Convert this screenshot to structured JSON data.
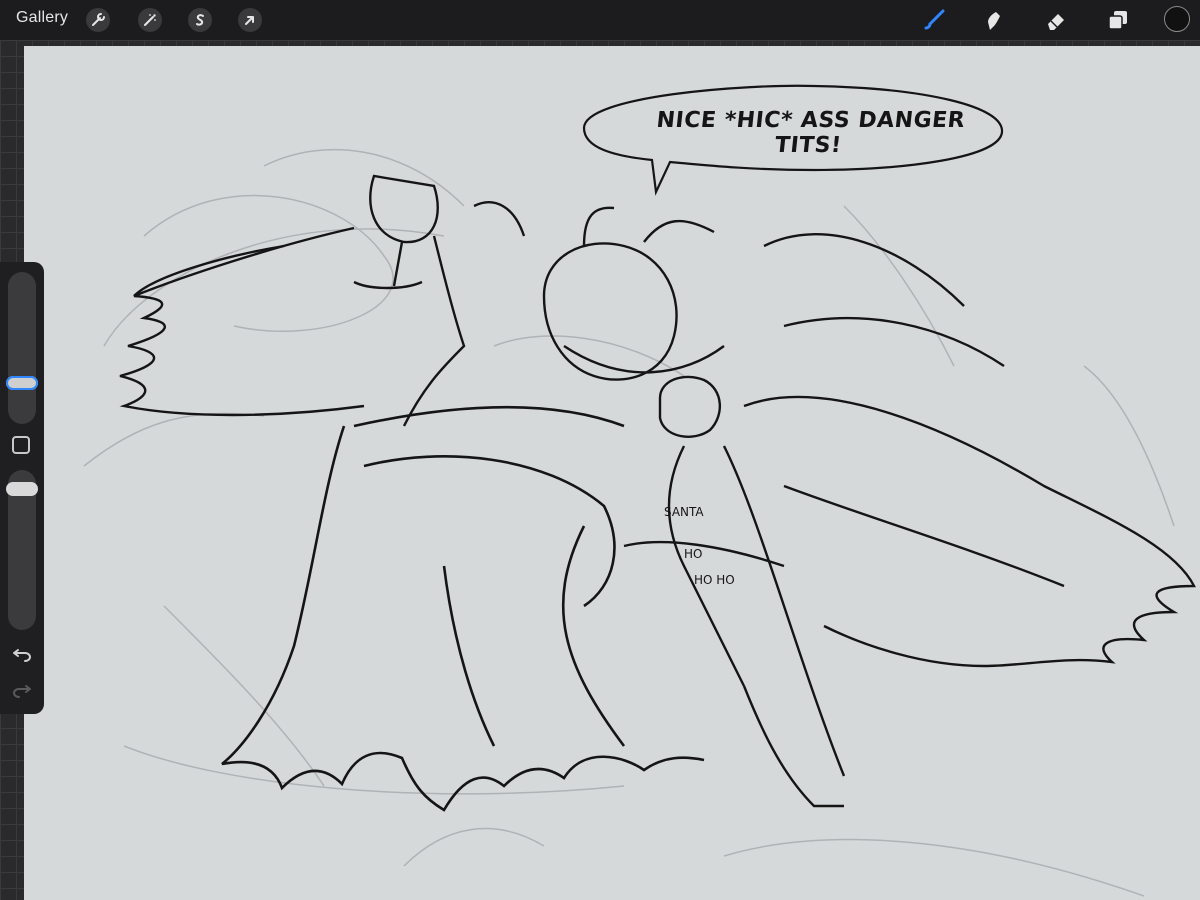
{
  "topbar": {
    "gallery_label": "Gallery",
    "left_tools": [
      "wrench-icon",
      "magic-wand-icon",
      "selection-icon",
      "transform-arrow-icon"
    ],
    "right_tools": [
      "brush-icon",
      "smudge-icon",
      "eraser-icon",
      "layers-icon"
    ],
    "active_tool": "brush-icon",
    "current_color": "#111111",
    "accent_color": "#2f86ff"
  },
  "canvas": {
    "speech_bubble_text": "NICE *HIC* ASS DANGER TITS!"
  },
  "sidebar": {
    "brush_size_slider": "size",
    "opacity_slider": "opacity",
    "modify_button": "square-icon",
    "undo": "undo-icon",
    "redo": "redo-icon"
  }
}
